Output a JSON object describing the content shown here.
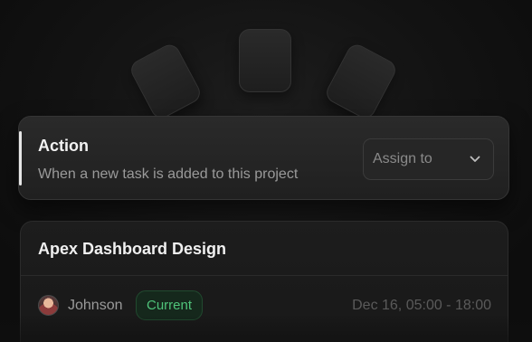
{
  "action": {
    "title": "Action",
    "description": "When a new task is added to this project",
    "assign_select": {
      "selected_label": "Assign to",
      "icon": "chevron-down-icon"
    }
  },
  "task": {
    "title": "Apex Dashboard Design",
    "assignee": {
      "name": "Johnson",
      "avatar": "avatar-icon"
    },
    "status_badge": "Current",
    "time_range": "Dec 16, 05:00 - 18:00"
  },
  "colors": {
    "background": "#0f0f0f",
    "status_green": "#4fc37a",
    "accent_bar": "#e6e6e6"
  }
}
